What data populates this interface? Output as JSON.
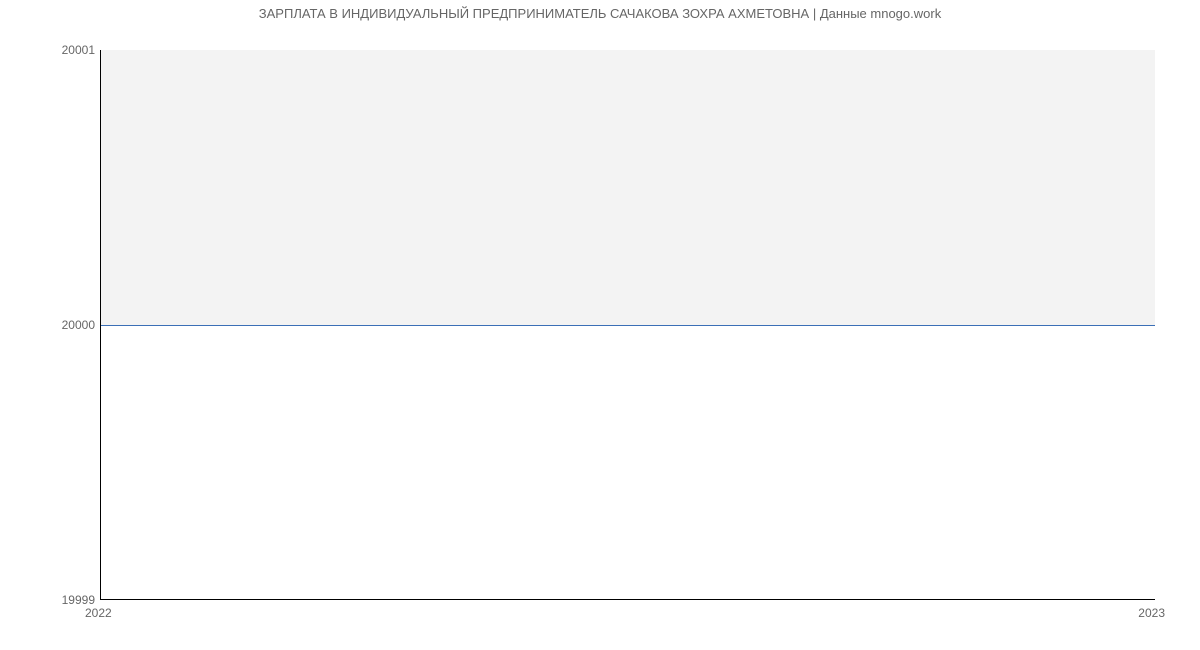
{
  "chart_data": {
    "type": "line",
    "title": "ЗАРПЛАТА В ИНДИВИДУАЛЬНЫЙ ПРЕДПРИНИМАТЕЛЬ САЧАКОВА ЗОХРА АХМЕТОВНА | Данные mnogo.work",
    "x": [
      2022,
      2023
    ],
    "series": [
      {
        "name": "Зарплата",
        "values": [
          20000,
          20000
        ],
        "color": "#3b6fb6"
      }
    ],
    "xlabel": "",
    "ylabel": "",
    "ylim": [
      19999,
      20001
    ],
    "y_ticks": [
      19999,
      20000,
      20001
    ],
    "x_ticks": [
      2022,
      2023
    ]
  },
  "ticks": {
    "y_top": "20001",
    "y_mid": "20000",
    "y_bottom": "19999",
    "x_left": "2022",
    "x_right": "2023"
  }
}
